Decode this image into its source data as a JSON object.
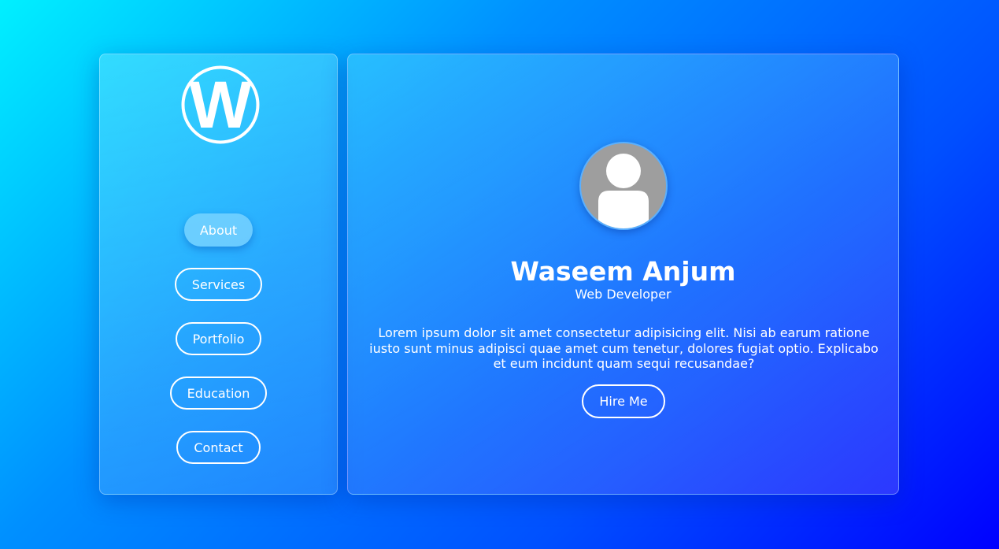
{
  "sidebar": {
    "logo": {
      "letter": "W",
      "icon": "w-logo-icon"
    },
    "nav": [
      {
        "label": "About",
        "active": true
      },
      {
        "label": "Services",
        "active": false
      },
      {
        "label": "Portfolio",
        "active": false
      },
      {
        "label": "Education",
        "active": false
      },
      {
        "label": "Contact",
        "active": false
      }
    ]
  },
  "profile": {
    "avatar_icon": "user-avatar-icon",
    "name": "Waseem Anjum",
    "role": "Web Developer",
    "bio": "Lorem ipsum dolor sit amet consectetur adipisicing elit. Nisi ab earum ratione iusto sunt minus adipisci quae amet cum tenetur, dolores fugiat optio. Explicabo et eum incidunt quam sequi recusandae?",
    "cta_label": "Hire Me"
  },
  "colors": {
    "accent": "#ffffff",
    "background_start": "#00f0ff",
    "background_end": "#0000ff",
    "avatar_bg": "#9e9e9e"
  }
}
